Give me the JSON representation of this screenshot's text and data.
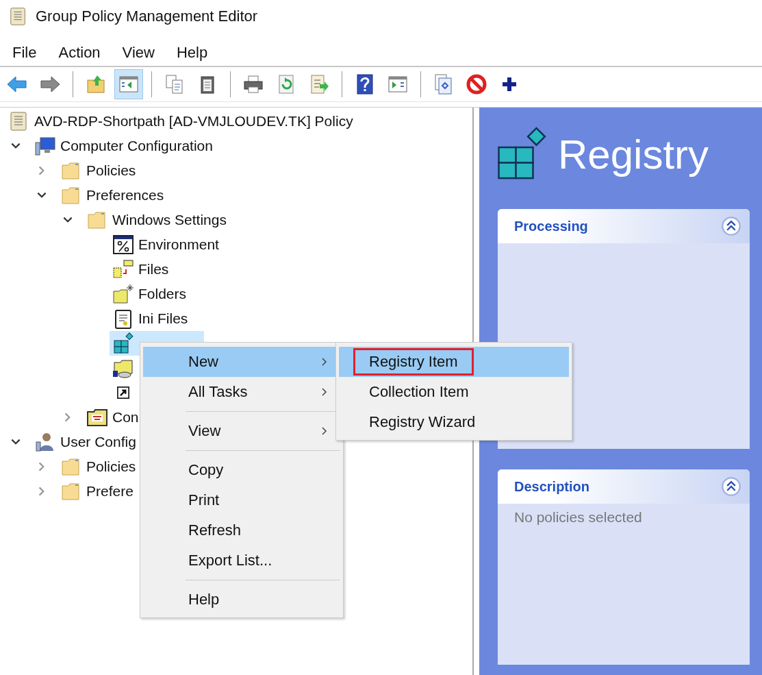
{
  "window": {
    "title": "Group Policy Management Editor"
  },
  "menu_bar": [
    "File",
    "Action",
    "View",
    "Help"
  ],
  "toolbar": [
    {
      "kind": "button",
      "selected": false
    },
    {
      "kind": "button",
      "selected": false
    },
    {
      "kind": "separator"
    },
    {
      "kind": "button",
      "selected": false
    },
    {
      "kind": "button",
      "selected": true
    },
    {
      "kind": "separator"
    },
    {
      "kind": "button",
      "selected": false
    },
    {
      "kind": "button",
      "selected": false
    },
    {
      "kind": "separator"
    },
    {
      "kind": "button",
      "selected": false
    },
    {
      "kind": "button",
      "selected": false
    },
    {
      "kind": "button",
      "selected": false
    },
    {
      "kind": "separator"
    },
    {
      "kind": "button",
      "selected": false
    },
    {
      "kind": "button",
      "selected": false
    },
    {
      "kind": "separator"
    },
    {
      "kind": "button",
      "selected": false
    },
    {
      "kind": "button",
      "selected": false
    },
    {
      "kind": "button",
      "selected": false
    }
  ],
  "tree": {
    "label": "AVD-RDP-Shortpath [AD-VMJLOUDEV.TK] Policy",
    "kind": "policy",
    "selected": false,
    "children": [
      {
        "label": "Computer Configuration",
        "kind": "computer",
        "selected": false,
        "expanded": true,
        "children": [
          {
            "label": "Policies",
            "kind": "folder",
            "selected": false,
            "expanded": false
          },
          {
            "label": "Preferences",
            "kind": "folder",
            "selected": false,
            "expanded": true,
            "children": [
              {
                "label": "Windows Settings",
                "kind": "folder",
                "selected": false,
                "expanded": true,
                "children": [
                  {
                    "label": "Environment",
                    "kind": "environment",
                    "selected": false
                  },
                  {
                    "label": "Files",
                    "kind": "files",
                    "selected": false
                  },
                  {
                    "label": "Folders",
                    "kind": "folders",
                    "selected": false
                  },
                  {
                    "label": "Ini Files",
                    "kind": "ini",
                    "selected": false
                  },
                  {
                    "kind": "registry",
                    "selected": true
                  },
                  {
                    "kind": "share",
                    "selected": false
                  },
                  {
                    "kind": "shortcut",
                    "selected": false
                  }
                ]
              },
              {
                "label": "Con",
                "kind": "control",
                "selected": false,
                "expanded": false
              }
            ]
          }
        ]
      },
      {
        "label": "User Config",
        "kind": "user",
        "selected": false,
        "expanded": true,
        "children": [
          {
            "label": "Policies",
            "kind": "folder",
            "selected": false,
            "expanded": false
          },
          {
            "label": "Prefere",
            "kind": "folder",
            "selected": false,
            "expanded": false
          }
        ]
      }
    ]
  },
  "details": {
    "title": "Registry",
    "panels": [
      {
        "title": "Processing"
      },
      {
        "title": "Description",
        "text": "No policies selected"
      }
    ]
  },
  "context_menu": [
    {
      "kind": "item",
      "label": "New",
      "submenu": true,
      "selected": true
    },
    {
      "kind": "item",
      "label": "All Tasks",
      "submenu": true,
      "selected": false
    },
    {
      "kind": "separator"
    },
    {
      "kind": "item",
      "label": "View",
      "submenu": true,
      "selected": false
    },
    {
      "kind": "separator"
    },
    {
      "kind": "item",
      "label": "Copy",
      "submenu": false,
      "selected": false
    },
    {
      "kind": "item",
      "label": "Print",
      "submenu": false,
      "selected": false
    },
    {
      "kind": "item",
      "label": "Refresh",
      "submenu": false,
      "selected": false
    },
    {
      "kind": "item",
      "label": "Export List...",
      "submenu": false,
      "selected": false
    },
    {
      "kind": "separator"
    },
    {
      "kind": "item",
      "label": "Help",
      "submenu": false,
      "selected": false
    }
  ],
  "submenu": [
    {
      "label": "Registry Item",
      "selected": true,
      "outlined": true
    },
    {
      "label": "Collection Item",
      "selected": false,
      "outlined": false
    },
    {
      "label": "Registry Wizard",
      "selected": false,
      "outlined": false
    }
  ]
}
